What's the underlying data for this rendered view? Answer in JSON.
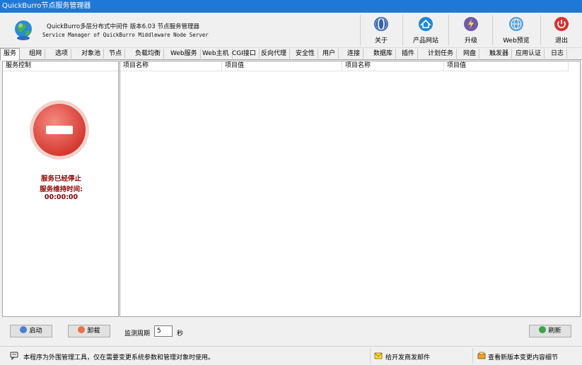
{
  "window": {
    "title": "QuickBurro节点服务管理器"
  },
  "header": {
    "line1": "QuickBurro多层分布式中间件  版本6.03  节点服务管理器",
    "line2": "Service Manager of QuickBurro Middleware Node Server",
    "buttons": [
      {
        "label": "关于",
        "icon": "about-icon",
        "color": "#3a5fa8"
      },
      {
        "label": "产品网站",
        "icon": "home-icon",
        "color": "#1e88d8"
      },
      {
        "label": "升级",
        "icon": "lightning-icon",
        "color": "#6e5aa8"
      },
      {
        "label": "Web预览",
        "icon": "globe-icon",
        "color": "#5aa0d8"
      },
      {
        "label": "退出",
        "icon": "power-icon",
        "color": "#d83030"
      }
    ]
  },
  "tabs": [
    "服务",
    "组网",
    "选项",
    "对象池",
    "节点",
    "负载均衡",
    "Web服务",
    "Web主机",
    "CGI接口",
    "反向代理",
    "安全性",
    "用户",
    "连接",
    "数据库",
    "插件",
    "计划任务",
    "网盘",
    "触发器",
    "应用认证",
    "日志"
  ],
  "active_tab": "服务",
  "left_panel": {
    "title": "服务控制",
    "status": "服务已经停止",
    "uptime_label": "服务维持时间:",
    "uptime": "00:00:00",
    "start_button": "启动",
    "unload_button": "卸载"
  },
  "table": {
    "columns": [
      "项目名称",
      "项目值",
      "项目名称",
      "项目值"
    ],
    "rows": []
  },
  "monitor": {
    "label": "监测周期",
    "value": "5",
    "unit": "秒",
    "refresh_button": "刷新"
  },
  "statusbar": {
    "message": "本程序为外围管理工具，仅在需要变更系统参数和管理对象时使用。",
    "email_link": "给开发商发邮件",
    "changelog_link": "查看新版本变更内容细节"
  },
  "colors": {
    "titlebar": "#1e78d7",
    "status_text": "#8b0000",
    "stop_red": "#e0504a"
  }
}
